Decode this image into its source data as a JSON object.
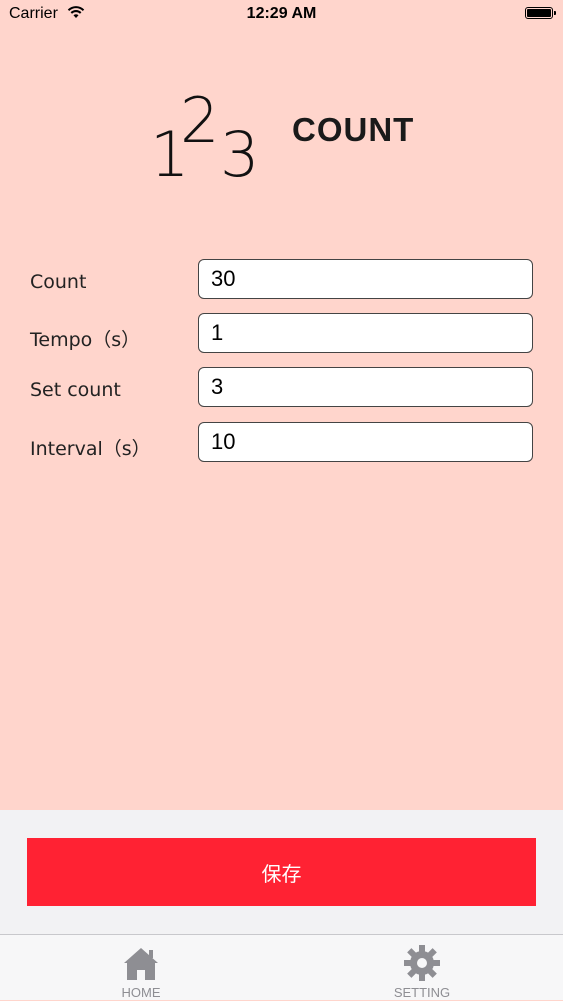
{
  "status_bar": {
    "carrier": "Carrier",
    "time": "12:29 AM"
  },
  "header": {
    "logo_digits": [
      "1",
      "2",
      "3"
    ],
    "title": "COUNT"
  },
  "form": {
    "fields": [
      {
        "label": "Count",
        "value": "30"
      },
      {
        "label": "Tempo（s）",
        "value": "1"
      },
      {
        "label": "Set count",
        "value": "3"
      },
      {
        "label": "Interval（s）",
        "value": "10"
      }
    ]
  },
  "save_button": {
    "label": "保存",
    "color": "#ff2233"
  },
  "tab_bar": {
    "tabs": [
      {
        "label": "HOME",
        "icon": "home-icon"
      },
      {
        "label": "SETTING",
        "icon": "gear-icon"
      }
    ]
  },
  "colors": {
    "background": "#ffd5cc",
    "accent": "#ff2233",
    "tab_inactive": "#8e8e93"
  }
}
